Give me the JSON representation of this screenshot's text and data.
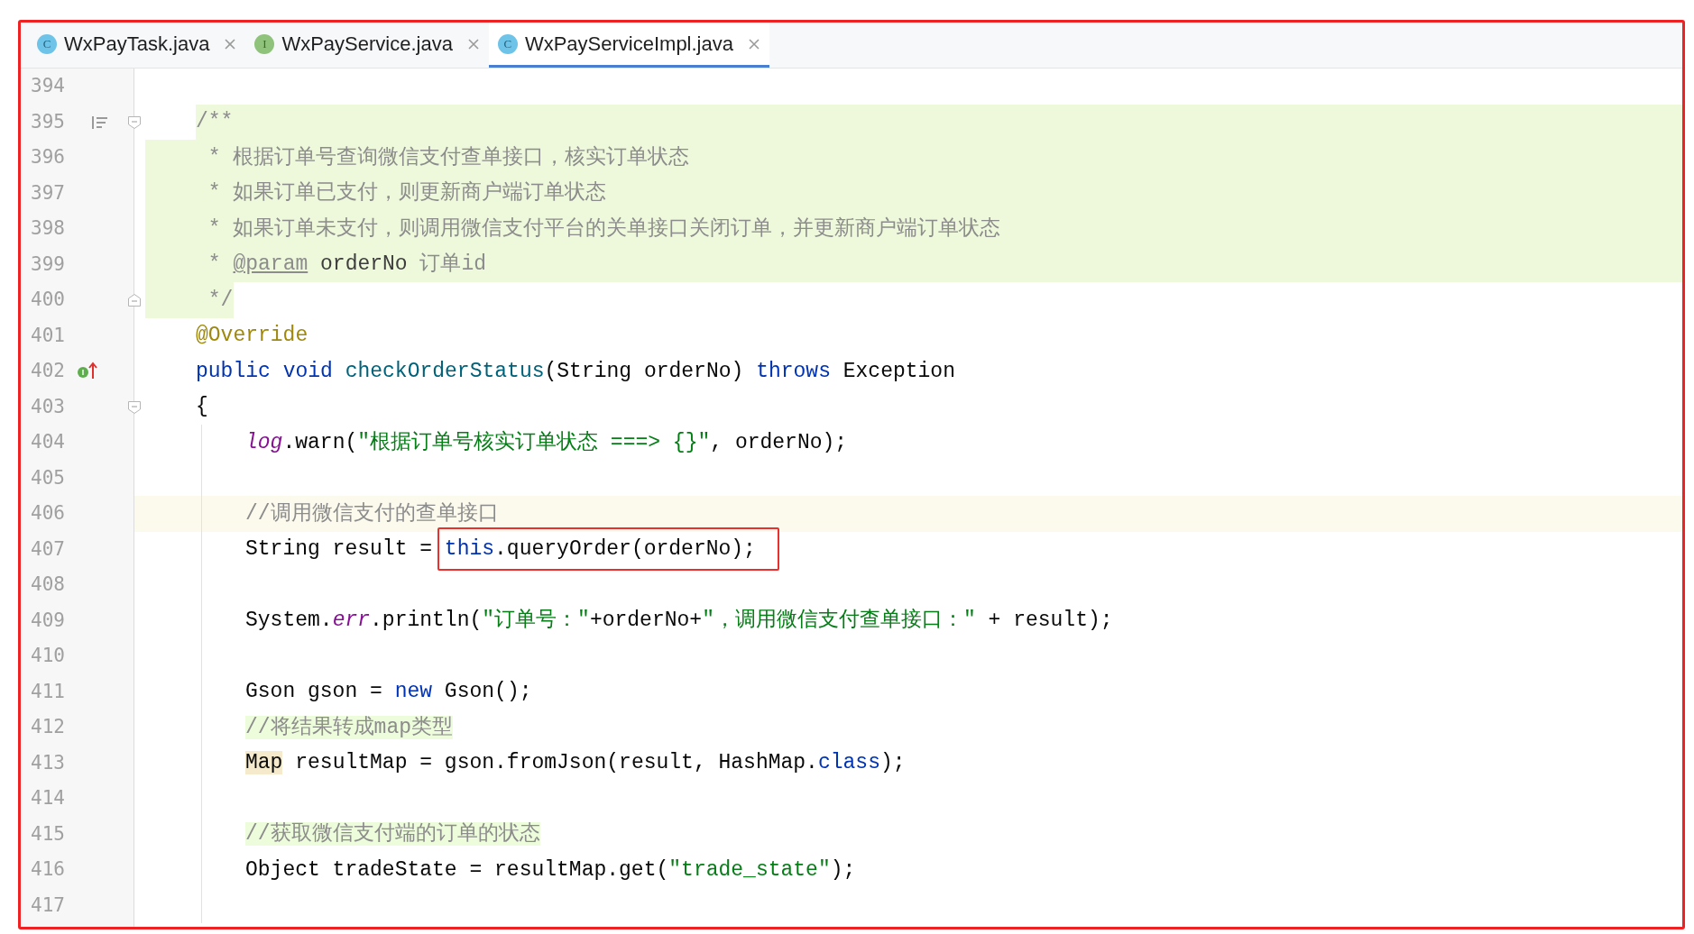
{
  "tabs": [
    {
      "label": "WxPayTask.java",
      "icon": {
        "kind": "class",
        "letter": "C"
      },
      "selected": false
    },
    {
      "label": "WxPayService.java",
      "icon": {
        "kind": "interface",
        "letter": "I"
      },
      "selected": false
    },
    {
      "label": "WxPayServiceImpl.java",
      "icon": {
        "kind": "class",
        "letter": "C"
      },
      "selected": true
    }
  ],
  "lines": [
    {
      "number": "394",
      "doc_comment": false,
      "current_line": false,
      "guide": false
    },
    {
      "number": "395",
      "doc_comment": true,
      "current_line": false,
      "guide": false,
      "markers": [
        {
          "kind": "doc-toggle"
        },
        {
          "kind": "fold-start"
        }
      ],
      "tokens": [
        {
          "text": "/**",
          "kind": "doc"
        }
      ]
    },
    {
      "number": "396",
      "doc_comment": true,
      "current_line": false,
      "guide": false,
      "tokens": [
        {
          "text": " * 根据订单号查询微信支付查单接口，核实订单状态",
          "kind": "doc"
        }
      ]
    },
    {
      "number": "397",
      "doc_comment": true,
      "current_line": false,
      "guide": false,
      "tokens": [
        {
          "text": " * 如果订单已支付，则更新商户端订单状态",
          "kind": "doc"
        }
      ]
    },
    {
      "number": "398",
      "doc_comment": true,
      "current_line": false,
      "guide": false,
      "tokens": [
        {
          "text": " * 如果订单未支付，则调用微信支付平台的关单接口关闭订单，并更新商户端订单状态",
          "kind": "doc"
        }
      ]
    },
    {
      "number": "399",
      "doc_comment": true,
      "current_line": false,
      "guide": false,
      "tokens": [
        {
          "text": " * ",
          "kind": "doc"
        },
        {
          "text": "@param",
          "kind": "doc-tag"
        },
        {
          "text": " orderNo",
          "kind": "doc-param"
        },
        {
          "text": " 订单id",
          "kind": "doc"
        }
      ]
    },
    {
      "number": "400",
      "doc_comment": true,
      "current_line": false,
      "guide": false,
      "markers": [
        {
          "kind": "fold-end"
        }
      ],
      "tokens": [
        {
          "text": " */",
          "kind": "doc"
        }
      ]
    },
    {
      "number": "401",
      "doc_comment": false,
      "current_line": false,
      "guide": false,
      "tokens": [
        {
          "text": "@Override",
          "kind": "annotation"
        }
      ]
    },
    {
      "number": "402",
      "doc_comment": false,
      "current_line": false,
      "guide": false,
      "markers": [
        {
          "kind": "implements"
        }
      ],
      "tokens": [
        {
          "text": "public",
          "kind": "keyword"
        },
        {
          "text": " void",
          "kind": "keyword"
        },
        {
          "text": " checkOrderStatus",
          "kind": "method"
        },
        {
          "text": "(String orderNo) ",
          "kind": "plain"
        },
        {
          "text": "throws",
          "kind": "keyword"
        },
        {
          "text": " Exception",
          "kind": "plain"
        }
      ]
    },
    {
      "number": "403",
      "doc_comment": false,
      "current_line": false,
      "guide": false,
      "markers": [
        {
          "kind": "fold-start"
        }
      ],
      "tokens": [
        {
          "text": "{",
          "kind": "plain"
        }
      ],
      "children": [
        {
          "number": "404",
          "doc_comment": false,
          "current_line": false,
          "guide": true,
          "tokens": [
            {
              "text": "log",
              "kind": "static"
            },
            {
              "text": ".warn(",
              "kind": "plain"
            },
            {
              "text": "\"根据订单号核实订单状态 ===> {}\"",
              "kind": "string"
            },
            {
              "text": ", orderNo);",
              "kind": "plain"
            }
          ]
        },
        {
          "number": "405",
          "doc_comment": false,
          "current_line": false,
          "guide": true
        },
        {
          "number": "406",
          "doc_comment": false,
          "current_line": true,
          "guide": true,
          "tokens": [
            {
              "text": "//调用微信支付的查单接口",
              "kind": "comment"
            }
          ]
        },
        {
          "number": "407",
          "doc_comment": false,
          "current_line": false,
          "guide": true,
          "tokens": [
            {
              "text": "String result = ",
              "kind": "plain",
              "boxed": false
            },
            {
              "text": "this",
              "kind": "keyword",
              "boxed": true
            },
            {
              "text": ".queryOrder(orderNo);",
              "kind": "plain",
              "boxed": true
            }
          ]
        },
        {
          "number": "408",
          "doc_comment": false,
          "current_line": false,
          "guide": true
        },
        {
          "number": "409",
          "doc_comment": false,
          "current_line": false,
          "guide": true,
          "tokens": [
            {
              "text": "System.",
              "kind": "plain"
            },
            {
              "text": "err",
              "kind": "static"
            },
            {
              "text": ".println(",
              "kind": "plain"
            },
            {
              "text": "\"订单号：\"",
              "kind": "string"
            },
            {
              "text": "+orderNo+",
              "kind": "plain"
            },
            {
              "text": "\"，调用微信支付查单接口：\"",
              "kind": "string"
            },
            {
              "text": " + result);",
              "kind": "plain"
            }
          ]
        },
        {
          "number": "410",
          "doc_comment": false,
          "current_line": false,
          "guide": true
        },
        {
          "number": "411",
          "doc_comment": false,
          "current_line": false,
          "guide": true,
          "tokens": [
            {
              "text": "Gson gson = ",
              "kind": "plain"
            },
            {
              "text": "new",
              "kind": "keyword"
            },
            {
              "text": " Gson();",
              "kind": "plain"
            }
          ]
        },
        {
          "number": "412",
          "doc_comment": false,
          "current_line": false,
          "guide": true,
          "tokens": [
            {
              "text": "//将结果转成map类型",
              "kind": "comment-mark"
            }
          ]
        },
        {
          "number": "413",
          "doc_comment": false,
          "current_line": false,
          "guide": true,
          "tokens": [
            {
              "text": "Map",
              "kind": "type-mark"
            },
            {
              "text": " resultMap = gson.fromJson(result, HashMap.",
              "kind": "plain"
            },
            {
              "text": "class",
              "kind": "keyword"
            },
            {
              "text": ");",
              "kind": "plain"
            }
          ]
        },
        {
          "number": "414",
          "doc_comment": false,
          "current_line": false,
          "guide": true
        },
        {
          "number": "415",
          "doc_comment": false,
          "current_line": false,
          "guide": true,
          "tokens": [
            {
              "text": "//获取微信支付端的订单的状态",
              "kind": "comment-mark"
            }
          ]
        },
        {
          "number": "416",
          "doc_comment": false,
          "current_line": false,
          "guide": true,
          "tokens": [
            {
              "text": "Object tradeState = resultMap.get(",
              "kind": "plain"
            },
            {
              "text": "\"trade_state\"",
              "kind": "string"
            },
            {
              "text": ");",
              "kind": "plain"
            }
          ]
        },
        {
          "number": "417",
          "doc_comment": false,
          "current_line": false,
          "guide": true
        }
      ]
    }
  ]
}
